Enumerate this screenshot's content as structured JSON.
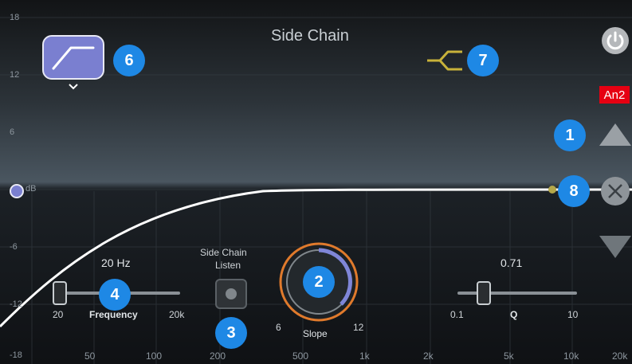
{
  "title": "Side Chain",
  "y_axis_labels": [
    "18",
    "12",
    "6",
    "dB",
    "-6",
    "-12",
    "-18"
  ],
  "x_axis_labels": [
    "50",
    "100",
    "200",
    "500",
    "1k",
    "2k",
    "5k",
    "10k",
    "20k"
  ],
  "badges": {
    "b1": "1",
    "b2": "2",
    "b3": "3",
    "b4": "4",
    "b6": "6",
    "b7": "7",
    "b8": "8"
  },
  "an2_label": "An2",
  "frequency": {
    "value": "20 Hz",
    "label": "Frequency",
    "min": "20",
    "max": "20k"
  },
  "side_chain_listen": {
    "label_line1": "Side Chain",
    "label_line2": "Listen"
  },
  "slope": {
    "label": "Slope",
    "min": "6",
    "max": "12"
  },
  "q": {
    "value": "0.71",
    "label": "Q",
    "min": "0.1",
    "max": "10"
  },
  "icons": {
    "filter_type": "high-pass-filter-icon",
    "sidechain_connector": "sidechain-connector-icon",
    "power": "power-icon",
    "move_up": "triangle-up-icon",
    "move_down": "triangle-down-icon",
    "remove": "close-icon"
  },
  "colors": {
    "accent_blue": "#1e88e5",
    "filter_button": "#7a7fd0",
    "an2_badge": "#e60012",
    "connector": "#c8b23a",
    "knob_ring": "#e07a2c"
  }
}
